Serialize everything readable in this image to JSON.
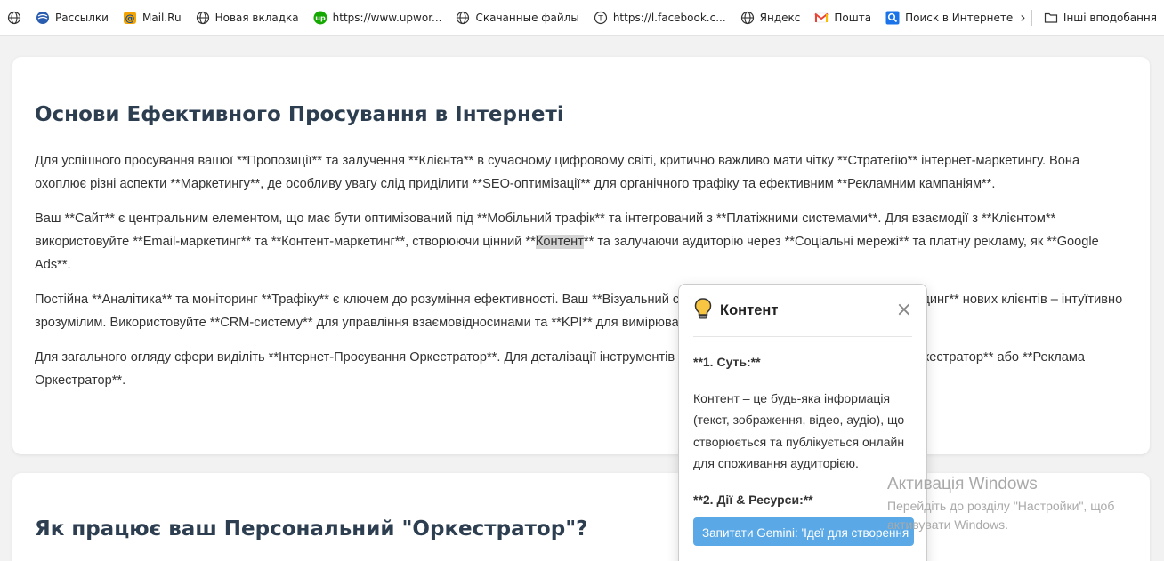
{
  "bookmarks": [
    {
      "label": "",
      "icon": "globe-icon"
    },
    {
      "label": "Рассылки",
      "icon": "mailings-icon"
    },
    {
      "label": "Mail.Ru",
      "icon": "mailru-icon"
    },
    {
      "label": "Новая вкладка",
      "icon": "globe-icon"
    },
    {
      "label": "https://www.upwor...",
      "icon": "upwork-icon"
    },
    {
      "label": "Скачанные файлы",
      "icon": "globe-icon"
    },
    {
      "label": "https://l.facebook.c...",
      "icon": "tor-icon"
    },
    {
      "label": "Яндекс",
      "icon": "globe-icon"
    },
    {
      "label": "Пошта",
      "icon": "gmail-icon"
    },
    {
      "label": "Поиск в Интернете",
      "icon": "search-icon"
    }
  ],
  "other_bookmarks": "Інші вподобання",
  "section1": {
    "title": "Основи Ефективного Просування в Інтернеті",
    "p1": "Для успішного просування вашої **Пропозиції** та залучення **Клієнта** в сучасному цифровому світі, критично важливо мати чітку **Стратегію** інтернет-маркетингу. Вона охоплює різні аспекти **Маркетингу**, де особливу увагу слід приділити **SEO-оптимізації** для органічного трафіку та ефективним **Рекламним кампаніям**.",
    "p2_before": "Ваш **Сайт** є центральним елементом, що має бути оптимізований під **Мобільний трафік** та інтегрований з **Платіжними системами**. Для взаємодії з **Клієнтом** використовуйте **Email-маркетинг** та **Контент-маркетинг**, створюючи цінний **",
    "p2_highlight": "Контент",
    "p2_after": "** та залучаючи аудиторію через **Соціальні мережі** та платну рекламу, як **Google Ads**.",
    "p3": "Постійна **Аналітика** та моніторинг **Трафіку** є ключем до розуміння ефективності. Ваш **Візуальний стиль** має бути узгодженими, а **Онбординг** нових клієнтів – інтуїтивно зрозумілим. Використовуйте **CRM-систему** для управління взаємовідносинами та **KPI** для вимірювання прогресу.",
    "p4": "Для загального огляду сфери виділіть **Інтернет-Просування Оркестратор**. Для деталізації інструментів оберіть **SEO Оркестратор**, **SMM Оркестратор** або **Реклама Оркестратор**."
  },
  "section2": {
    "title": "Як працює ваш Персональний \"Оркестратор\"?"
  },
  "popup": {
    "title": "Контент",
    "close": "×",
    "h1": "**1. Суть:**",
    "text": "Контент – це будь-яка інформація (текст, зображення, відео, аудіо), що створюється та публікується онлайн для споживання аудиторією.",
    "h2": "**2. Дії & Ресурси:**",
    "button": "Запитати Gemini: 'Ідеї для створення"
  },
  "watermark": {
    "title": "Активація Windows",
    "text": "Перейдіть до розділу \"Настройки\", щоб активувати Windows."
  }
}
